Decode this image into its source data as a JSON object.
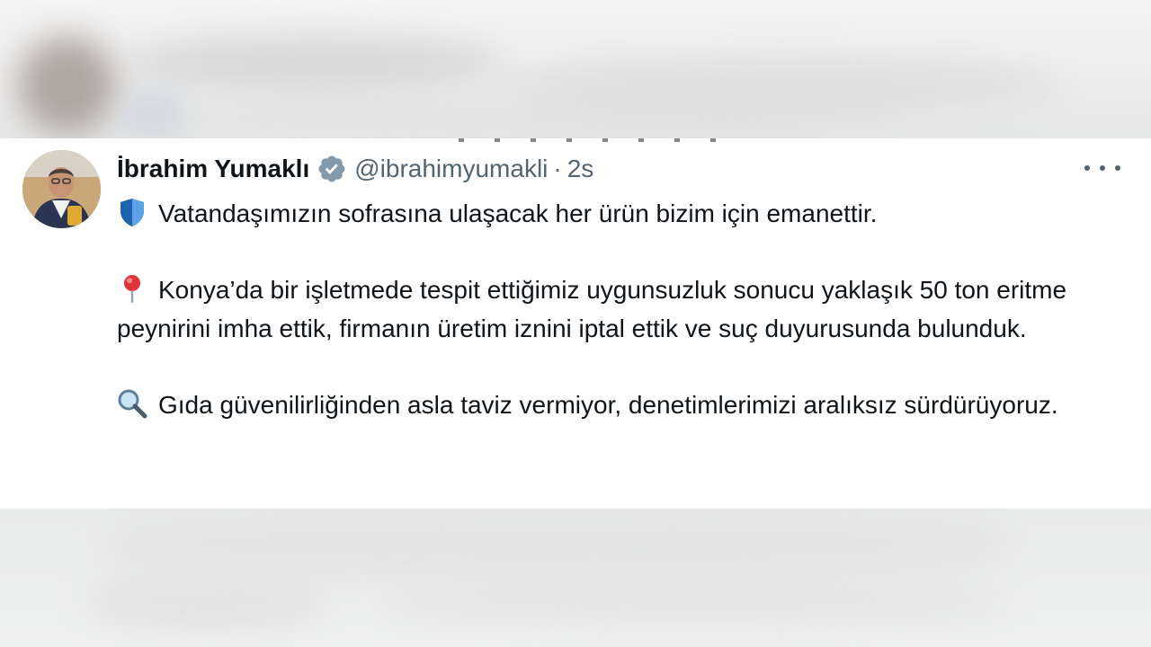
{
  "tweet": {
    "author": {
      "display_name": "İbrahim Yumaklı",
      "handle": "@ibrahimyumakli",
      "verified_badge_icon": "verified-badge-gray"
    },
    "separator": "·",
    "time": "2s",
    "more_menu_icon": "ellipsis-icon",
    "paragraphs": [
      {
        "emoji_icon": "shield-icon",
        "text": "Vatandaşımızın sofrasına ulaşacak her ürün bizim için emanettir."
      },
      {
        "emoji_icon": "round-pushpin-icon",
        "text": "Konya’da bir işletmede tespit ettiğimiz uygunsuzluk sonucu yaklaşık 50 ton eritme peynirini imha ettik, firmanın üretim iznini iptal ettik ve suç duyurusunda bulunduk."
      },
      {
        "emoji_icon": "magnifying-glass-icon",
        "text": "Gıda güvenilirliğinden asla taviz vermiyor, denetimlerimizi aralıksız sürdürüyoruz."
      }
    ]
  },
  "colors": {
    "text_primary": "#0f1419",
    "text_secondary": "#536471",
    "verified_badge": "#829aab",
    "shield": "#2f7fd1"
  }
}
